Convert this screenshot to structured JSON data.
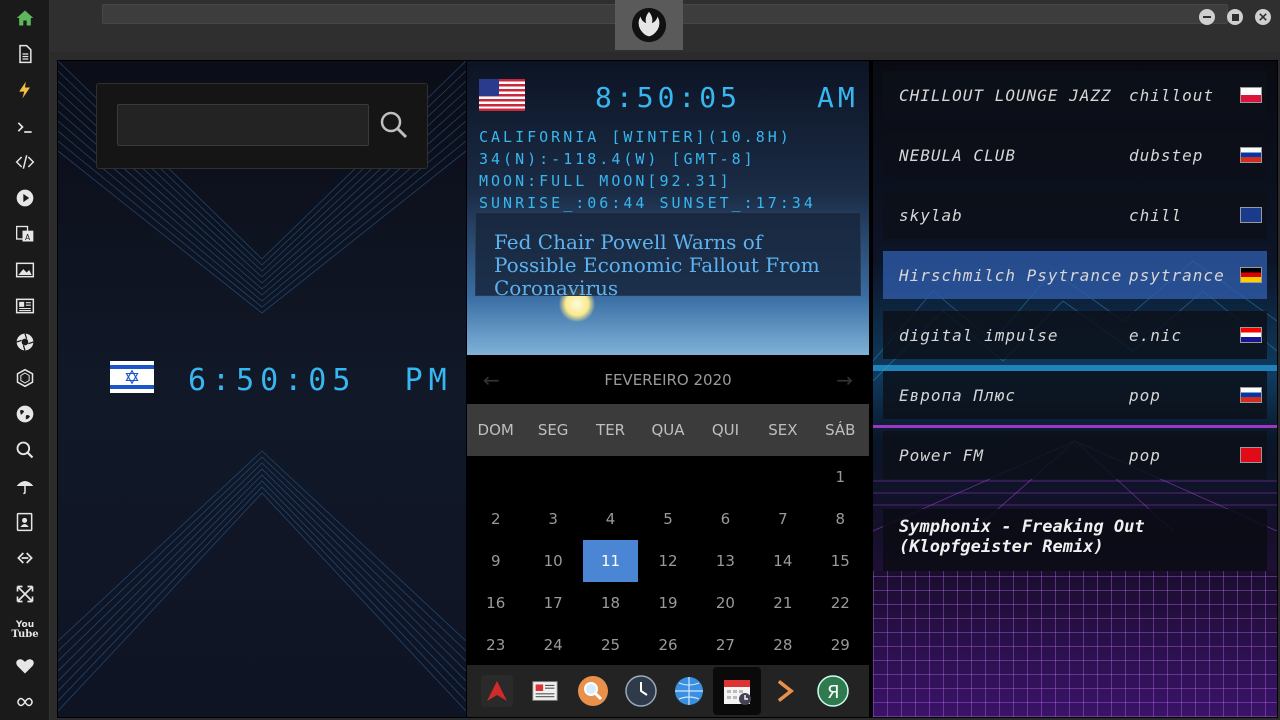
{
  "sidebar": {
    "items": [
      {
        "icon": "home-icon",
        "color": "#5cb85c"
      },
      {
        "icon": "document-icon"
      },
      {
        "icon": "lightning-icon",
        "color": "#f0c040"
      },
      {
        "icon": "terminal-icon"
      },
      {
        "icon": "code-icon"
      },
      {
        "icon": "play-icon"
      },
      {
        "icon": "translate-icon"
      },
      {
        "icon": "image-icon"
      },
      {
        "icon": "news-icon"
      },
      {
        "icon": "aperture-icon"
      },
      {
        "icon": "hexagon-icon"
      },
      {
        "icon": "globe-icon"
      },
      {
        "icon": "search-icon"
      },
      {
        "icon": "umbrella-icon"
      },
      {
        "icon": "contact-icon"
      },
      {
        "icon": "link-icon"
      },
      {
        "icon": "expand-icon"
      },
      {
        "icon": "youtube-icon",
        "label": "You Tube"
      },
      {
        "icon": "heart-icon"
      },
      {
        "icon": "infinity-icon"
      }
    ]
  },
  "left_clock": {
    "flag": "israel-flag",
    "time": "6:50:05",
    "ampm": "PM"
  },
  "search": {
    "placeholder": ""
  },
  "mid_clock": {
    "flag": "usa-flag",
    "time": "8:50:05",
    "ampm": "AM",
    "lines": [
      "CALIFORNIA [WINTER](10.8H)",
      "34(N):-118.4(W) [GMT-8]",
      "MOON:FULL MOON[92.31]",
      "SUNRISE_:06:44 SUNSET_:17:34"
    ]
  },
  "news": {
    "headline": "Fed Chair Powell Warns of Possible Economic Fallout From Coronavirus"
  },
  "calendar": {
    "month": "FEVEREIRO 2020",
    "weekdays": [
      "DOM",
      "SEG",
      "TER",
      "QUA",
      "QUI",
      "SEX",
      "SÁB"
    ],
    "rows": [
      [
        "",
        "",
        "",
        "",
        "",
        "",
        "1"
      ],
      [
        "2",
        "3",
        "4",
        "5",
        "6",
        "7",
        "8"
      ],
      [
        "9",
        "10",
        "11",
        "12",
        "13",
        "14",
        "15"
      ],
      [
        "16",
        "17",
        "18",
        "19",
        "20",
        "21",
        "22"
      ],
      [
        "23",
        "24",
        "25",
        "26",
        "27",
        "28",
        "29"
      ]
    ],
    "today": "11",
    "today_color": "#4a86d4"
  },
  "dock": {
    "items": [
      "arrow-app-icon",
      "newspaper-icon",
      "magnifier-icon",
      "clock-icon",
      "globe-icon",
      "calendar-icon",
      "chevron-right-icon",
      "yandex-icon"
    ]
  },
  "radio": {
    "stations": [
      {
        "name": "CHILLOUT LOUNGE JAZZ",
        "genre": "chillout",
        "flag": "poland-flag"
      },
      {
        "name": "NEBULA CLUB",
        "genre": "dubstep",
        "flag": "russia-flag"
      },
      {
        "name": "skylab",
        "genre": "chill",
        "flag": "uk-flag"
      },
      {
        "name": "Hirschmilch Psytrance",
        "genre": "psytrance",
        "flag": "germany-flag"
      },
      {
        "name": "digital impulse",
        "genre": "e.nic",
        "flag": "croatia-flag"
      },
      {
        "name": "Европа Плюс",
        "genre": "pop",
        "flag": "russia-flag"
      },
      {
        "name": "Power FM",
        "genre": "pop",
        "flag": "turkey-flag"
      }
    ],
    "active_index": 3,
    "now_playing": "Symphonix - Freaking Out (Klopfgeister Remix)"
  },
  "colors": {
    "accent": "#38b6f0",
    "active_station": "#305caa"
  }
}
